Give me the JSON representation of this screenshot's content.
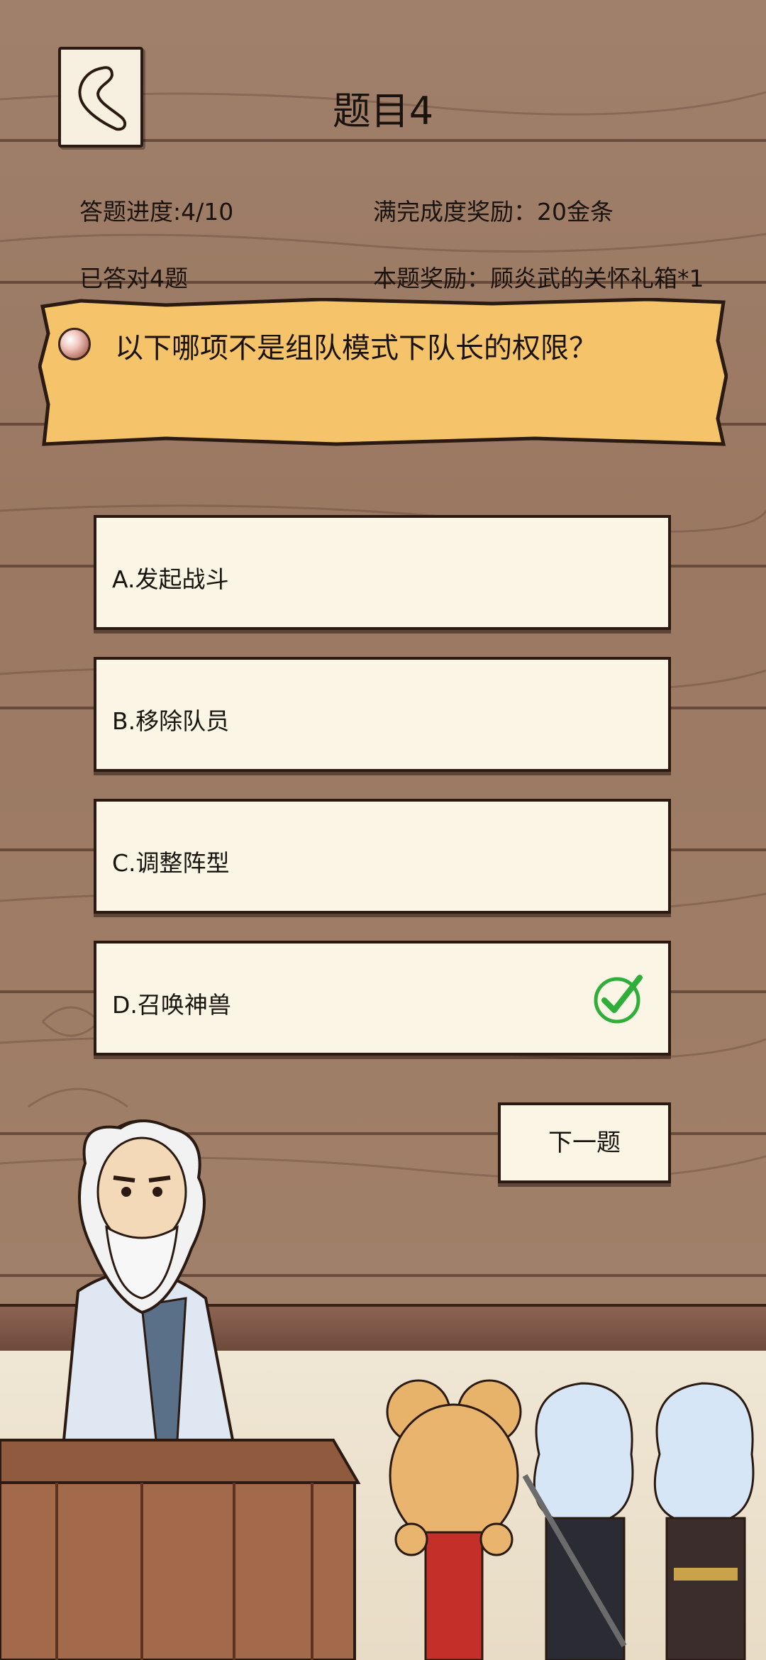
{
  "header": {
    "title": "题目4"
  },
  "info": {
    "progress": "答题进度:4/10",
    "full_reward": "满完成度奖励：20金条",
    "correct_count": "已答对4题",
    "question_reward": "本题奖励：顾炎武的关怀礼箱*1"
  },
  "question": {
    "text": "以下哪项不是组队模式下队长的权限？"
  },
  "options": [
    {
      "label": "A.发起战斗",
      "selected": false
    },
    {
      "label": "B.移除队员",
      "selected": false
    },
    {
      "label": "C.调整阵型",
      "selected": false
    },
    {
      "label": "D.召唤神兽",
      "selected": true
    }
  ],
  "next_button": {
    "label": "下一题"
  },
  "colors": {
    "banner": "#f5c46a",
    "option_bg": "#fbf5e6",
    "check_green": "#2fae3a",
    "wall": "#9d7a64"
  },
  "icons": {
    "back": "back-arrow-icon",
    "check": "check-circle-icon",
    "bead": "pearl-icon"
  }
}
